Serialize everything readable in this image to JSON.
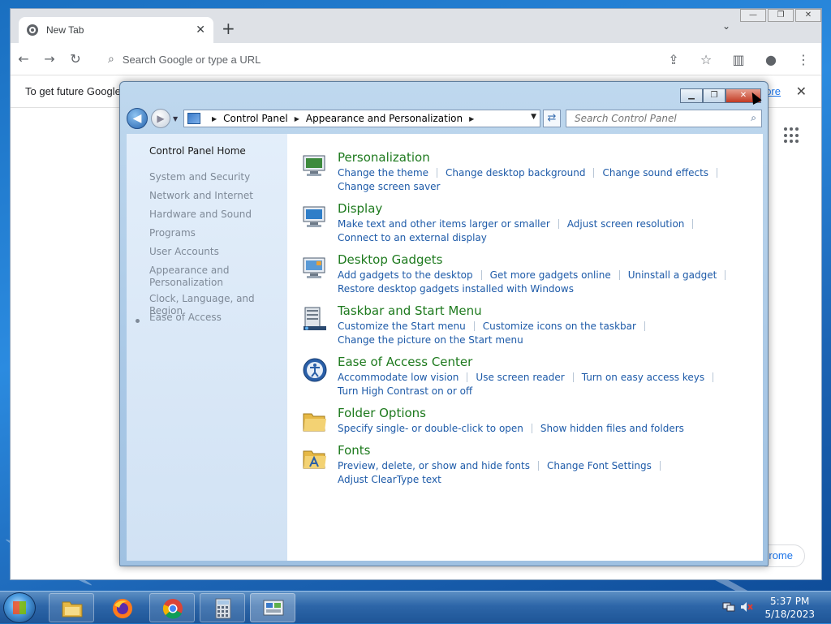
{
  "browser": {
    "tab_title": "New Tab",
    "omnibox_placeholder": "Search Google or type a URL",
    "infobar_text": "To get future Google",
    "infobar_link": "ore",
    "customize_label": "rome",
    "window_controls": {
      "minimize": "—",
      "maximize": "❐",
      "close": "✕"
    }
  },
  "control_panel": {
    "address": {
      "crumbs": [
        "Control Panel",
        "Appearance and Personalization"
      ]
    },
    "search_placeholder": "Search Control Panel",
    "sidebar": {
      "home": "Control Panel Home",
      "items": [
        "System and Security",
        "Network and Internet",
        "Hardware and Sound",
        "Programs",
        "User Accounts",
        "Appearance and Personalization",
        "Clock, Language, and Region",
        "Ease of Access"
      ],
      "current_index": 5
    },
    "categories": [
      {
        "title": "Personalization",
        "icon": "personalization-icon",
        "links": [
          "Change the theme",
          "Change desktop background",
          "Change sound effects",
          "Change screen saver"
        ]
      },
      {
        "title": "Display",
        "icon": "display-icon",
        "links": [
          "Make text and other items larger or smaller",
          "Adjust screen resolution",
          "Connect to an external display"
        ]
      },
      {
        "title": "Desktop Gadgets",
        "icon": "gadgets-icon",
        "links": [
          "Add gadgets to the desktop",
          "Get more gadgets online",
          "Uninstall a gadget",
          "Restore desktop gadgets installed with Windows"
        ]
      },
      {
        "title": "Taskbar and Start Menu",
        "icon": "taskbar-icon",
        "links": [
          "Customize the Start menu",
          "Customize icons on the taskbar",
          "Change the picture on the Start menu"
        ]
      },
      {
        "title": "Ease of Access Center",
        "icon": "ease-of-access-icon",
        "links": [
          "Accommodate low vision",
          "Use screen reader",
          "Turn on easy access keys",
          "Turn High Contrast on or off"
        ]
      },
      {
        "title": "Folder Options",
        "icon": "folder-options-icon",
        "links": [
          "Specify single- or double-click to open",
          "Show hidden files and folders"
        ]
      },
      {
        "title": "Fonts",
        "icon": "fonts-icon",
        "links": [
          "Preview, delete, or show and hide fonts",
          "Change Font Settings",
          "Adjust ClearType text"
        ]
      }
    ]
  },
  "taskbar": {
    "time": "5:37 PM",
    "date": "5/18/2023",
    "apps": [
      "explorer-icon",
      "firefox-icon",
      "chrome-icon",
      "calculator-icon",
      "control-panel-icon"
    ]
  },
  "colors": {
    "category_title": "#1e7a1e",
    "link": "#1d5aa8",
    "sidebar_inactive": "#7f8a98"
  }
}
